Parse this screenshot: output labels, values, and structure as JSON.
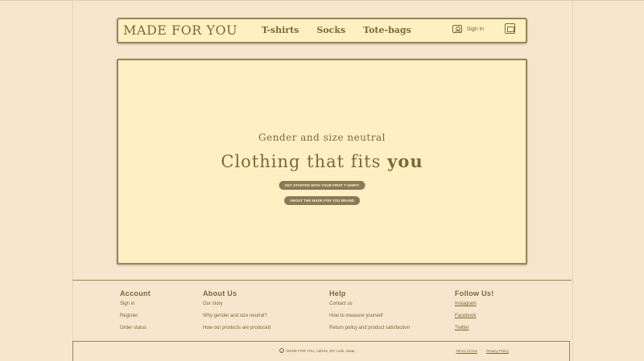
{
  "header": {
    "logo": "MADE FOR YOU",
    "nav": [
      "T-shirts",
      "Socks",
      "Tote-bags"
    ],
    "signin_label": "Sign in"
  },
  "hero": {
    "subtitle": "Gender and size neutral",
    "headline_main": "Clothing that fits ",
    "headline_emphasis": "you",
    "primary_button": "GET STARTED WITH YOUR FIRST T-SHIRT!",
    "secondary_button": "ABOUT THE MADE FOR YOU BRAND"
  },
  "footer": {
    "account": {
      "title": "Account",
      "links": [
        "Sign in",
        "Register",
        "Order status"
      ]
    },
    "about": {
      "title": "About Us",
      "links": [
        "Our story",
        "Why gender and size neutral?",
        "How our products are produced"
      ]
    },
    "help": {
      "title": "Help",
      "links": [
        "Contact us",
        "How to measure yourself",
        "Return policy and product satisfaction"
      ]
    },
    "follow": {
      "title": "Follow Us!",
      "links": [
        "Instagram",
        "Facebook",
        "Twitter"
      ]
    }
  },
  "bottom_bar": {
    "copy_symbol": "c",
    "copyright": "MADE FOR YOU, Adress, ZIP code, State.",
    "terms": "Terms of Use",
    "privacy": "Privacy Policy"
  },
  "colors": {
    "background": "#f5e6cd",
    "panel": "#fdf1c4",
    "brand_text": "#7b6a35",
    "button": "#8a7a58",
    "border": "#9a8456"
  },
  "icons": {
    "user": "user-icon",
    "cart": "shopping-bag-icon",
    "copyright": "copyright-icon"
  }
}
